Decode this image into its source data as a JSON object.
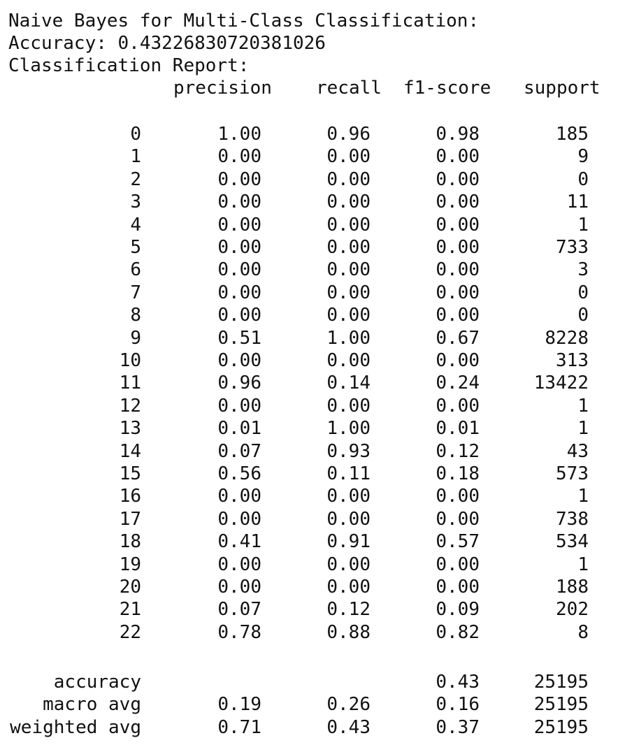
{
  "report": {
    "title": "Naive Bayes for Multi-Class Classification:",
    "accuracy_line": "Accuracy: 0.43226830720381026",
    "report_label": "Classification Report:",
    "headers": [
      "precision",
      "recall",
      "f1-score",
      "support"
    ],
    "rows": [
      {
        "label": "0",
        "precision": "1.00",
        "recall": "0.96",
        "f1": "0.98",
        "support": "185"
      },
      {
        "label": "1",
        "precision": "0.00",
        "recall": "0.00",
        "f1": "0.00",
        "support": "9"
      },
      {
        "label": "2",
        "precision": "0.00",
        "recall": "0.00",
        "f1": "0.00",
        "support": "0"
      },
      {
        "label": "3",
        "precision": "0.00",
        "recall": "0.00",
        "f1": "0.00",
        "support": "11"
      },
      {
        "label": "4",
        "precision": "0.00",
        "recall": "0.00",
        "f1": "0.00",
        "support": "1"
      },
      {
        "label": "5",
        "precision": "0.00",
        "recall": "0.00",
        "f1": "0.00",
        "support": "733"
      },
      {
        "label": "6",
        "precision": "0.00",
        "recall": "0.00",
        "f1": "0.00",
        "support": "3"
      },
      {
        "label": "7",
        "precision": "0.00",
        "recall": "0.00",
        "f1": "0.00",
        "support": "0"
      },
      {
        "label": "8",
        "precision": "0.00",
        "recall": "0.00",
        "f1": "0.00",
        "support": "0"
      },
      {
        "label": "9",
        "precision": "0.51",
        "recall": "1.00",
        "f1": "0.67",
        "support": "8228"
      },
      {
        "label": "10",
        "precision": "0.00",
        "recall": "0.00",
        "f1": "0.00",
        "support": "313"
      },
      {
        "label": "11",
        "precision": "0.96",
        "recall": "0.14",
        "f1": "0.24",
        "support": "13422"
      },
      {
        "label": "12",
        "precision": "0.00",
        "recall": "0.00",
        "f1": "0.00",
        "support": "1"
      },
      {
        "label": "13",
        "precision": "0.01",
        "recall": "1.00",
        "f1": "0.01",
        "support": "1"
      },
      {
        "label": "14",
        "precision": "0.07",
        "recall": "0.93",
        "f1": "0.12",
        "support": "43"
      },
      {
        "label": "15",
        "precision": "0.56",
        "recall": "0.11",
        "f1": "0.18",
        "support": "573"
      },
      {
        "label": "16",
        "precision": "0.00",
        "recall": "0.00",
        "f1": "0.00",
        "support": "1"
      },
      {
        "label": "17",
        "precision": "0.00",
        "recall": "0.00",
        "f1": "0.00",
        "support": "738"
      },
      {
        "label": "18",
        "precision": "0.41",
        "recall": "0.91",
        "f1": "0.57",
        "support": "534"
      },
      {
        "label": "19",
        "precision": "0.00",
        "recall": "0.00",
        "f1": "0.00",
        "support": "1"
      },
      {
        "label": "20",
        "precision": "0.00",
        "recall": "0.00",
        "f1": "0.00",
        "support": "188"
      },
      {
        "label": "21",
        "precision": "0.07",
        "recall": "0.12",
        "f1": "0.09",
        "support": "202"
      },
      {
        "label": "22",
        "precision": "0.78",
        "recall": "0.88",
        "f1": "0.82",
        "support": "8"
      }
    ],
    "summary": [
      {
        "label": "accuracy",
        "precision": "",
        "recall": "",
        "f1": "0.43",
        "support": "25195"
      },
      {
        "label": "macro avg",
        "precision": "0.19",
        "recall": "0.26",
        "f1": "0.16",
        "support": "25195"
      },
      {
        "label": "weighted avg",
        "precision": "0.71",
        "recall": "0.43",
        "f1": "0.37",
        "support": "25195"
      }
    ]
  }
}
